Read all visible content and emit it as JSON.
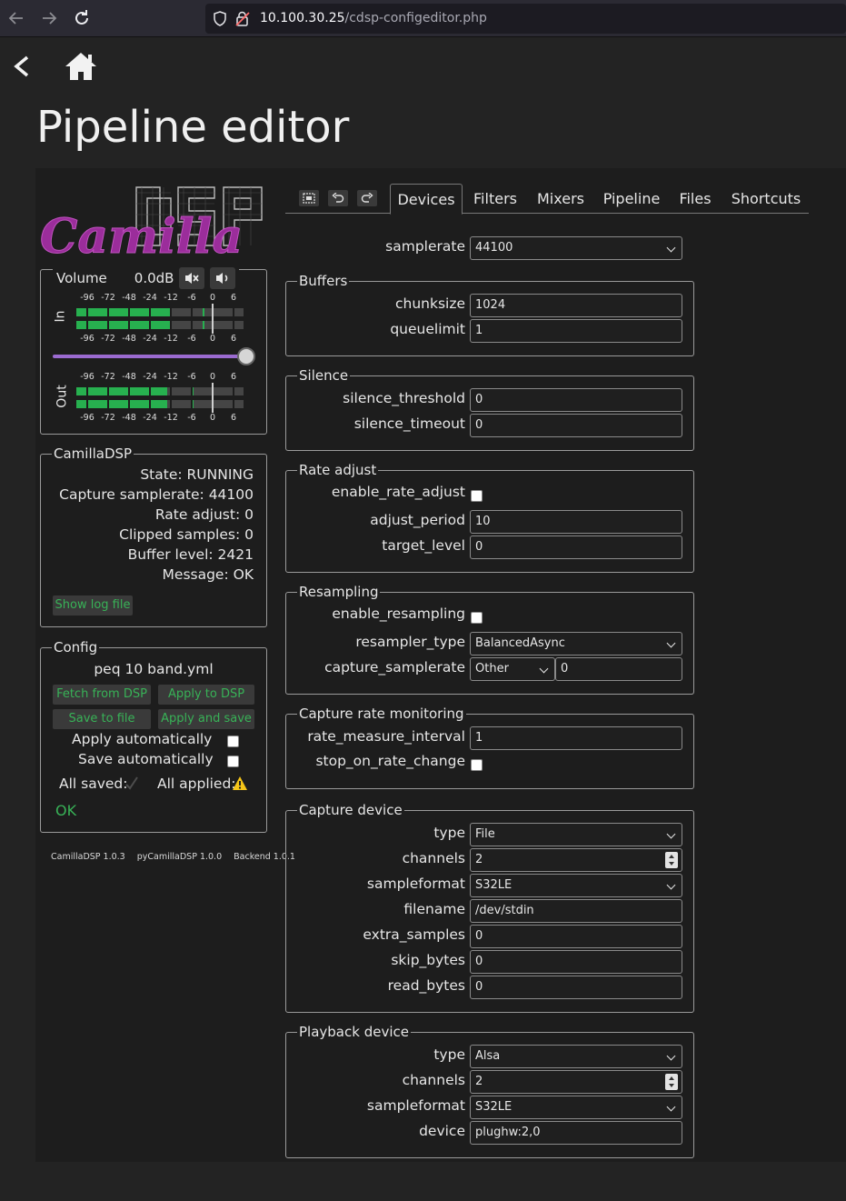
{
  "browser": {
    "url_host": "10.100.30.25",
    "url_path": "/cdsp-configeditor.php"
  },
  "page": {
    "title": "Pipeline editor"
  },
  "volume": {
    "label": "Volume",
    "value": "0.0dB",
    "slider_fraction": 1.0,
    "in_label": "In",
    "out_label": "Out",
    "scale": [
      "-96",
      "-72",
      "-48",
      "-24",
      "-12",
      "-6",
      "0",
      "6"
    ],
    "in_levels_db": [
      -12,
      -12
    ],
    "in_peaks_db": [
      -3,
      -3
    ],
    "out_levels_db": [
      -14,
      -14
    ],
    "out_peaks_db": [
      -6,
      -6
    ]
  },
  "status": {
    "legend": "CamillaDSP",
    "rows": [
      {
        "k": "State: ",
        "v": "RUNNING"
      },
      {
        "k": "Capture samplerate: ",
        "v": "44100"
      },
      {
        "k": "Rate adjust: ",
        "v": "0"
      },
      {
        "k": "Clipped samples: ",
        "v": "0"
      },
      {
        "k": "Buffer level: ",
        "v": "2421"
      },
      {
        "k": "Message: ",
        "v": "OK"
      }
    ],
    "show_log": "Show log file"
  },
  "config": {
    "legend": "Config",
    "filename": "peq 10 band.yml",
    "fetch": "Fetch from DSP",
    "apply": "Apply to DSP",
    "save": "Save to file",
    "apply_save": "Apply and save",
    "apply_auto": "Apply automatically",
    "save_auto": "Save automatically",
    "all_saved": "All saved:",
    "all_applied": "All applied:",
    "ok": "OK"
  },
  "versions": [
    "CamillaDSP 1.0.3",
    "pyCamillaDSP 1.0.0",
    "Backend 1.0.1"
  ],
  "tabs": [
    "Devices",
    "Filters",
    "Mixers",
    "Pipeline",
    "Files",
    "Shortcuts"
  ],
  "devices": {
    "samplerate": {
      "label": "samplerate",
      "value": "44100"
    },
    "buffers": {
      "legend": "Buffers",
      "chunksize_label": "chunksize",
      "chunksize": "1024",
      "queuelimit_label": "queuelimit",
      "queuelimit": "1"
    },
    "silence": {
      "legend": "Silence",
      "threshold_label": "silence_threshold",
      "threshold": "0",
      "timeout_label": "silence_timeout",
      "timeout": "0"
    },
    "rate_adjust": {
      "legend": "Rate adjust",
      "enable_label": "enable_rate_adjust",
      "period_label": "adjust_period",
      "period": "10",
      "target_label": "target_level",
      "target": "0"
    },
    "resampling": {
      "legend": "Resampling",
      "enable_label": "enable_resampling",
      "type_label": "resampler_type",
      "type": "BalancedAsync",
      "capture_label": "capture_samplerate",
      "capture_select": "Other",
      "capture_value": "0"
    },
    "monitoring": {
      "legend": "Capture rate monitoring",
      "interval_label": "rate_measure_interval",
      "interval": "1",
      "stop_label": "stop_on_rate_change"
    },
    "capture": {
      "legend": "Capture device",
      "type_label": "type",
      "type": "File",
      "channels_label": "channels",
      "channels": "2",
      "format_label": "sampleformat",
      "format": "S32LE",
      "filename_label": "filename",
      "filename": "/dev/stdin",
      "extra_label": "extra_samples",
      "extra": "0",
      "skip_label": "skip_bytes",
      "skip": "0",
      "read_label": "read_bytes",
      "read": "0"
    },
    "playback": {
      "legend": "Playback device",
      "type_label": "type",
      "type": "Alsa",
      "channels_label": "channels",
      "channels": "2",
      "format_label": "sampleformat",
      "format": "S32LE",
      "device_label": "device",
      "device": "plughw:2,0"
    }
  }
}
